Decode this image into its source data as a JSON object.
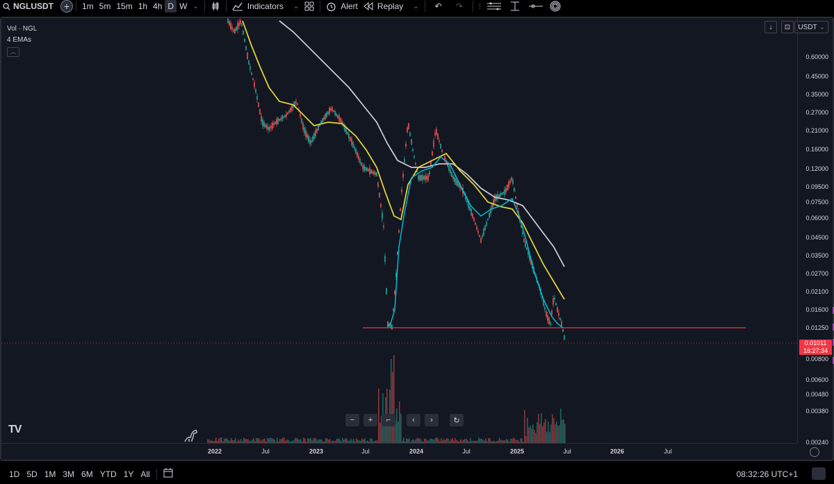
{
  "toolbar": {
    "symbol": "NGLUSDT",
    "intervals": [
      "1m",
      "5m",
      "15m",
      "1h",
      "4h",
      "D",
      "W"
    ],
    "active_interval": "D",
    "indicators_label": "Indicators",
    "alert_label": "Alert",
    "replay_label": "Replay"
  },
  "legend": {
    "volume": "Vol · NGL",
    "emas": "4 EMAs"
  },
  "currency": "USDT",
  "price_axis": {
    "labels": [
      "0.60000",
      "0.45000",
      "0.35000",
      "0.27000",
      "0.21000",
      "0.16000",
      "0.12000",
      "0.09500",
      "0.07500",
      "0.06000",
      "0.04500",
      "0.03500",
      "0.02700",
      "0.02100",
      "0.01600",
      "0.01250",
      "0.00800",
      "0.00600",
      "0.00480",
      "0.00380",
      "0.00240"
    ],
    "current_price": "0.01011",
    "countdown": "16:27:34"
  },
  "time_axis": {
    "labels": [
      "2022",
      "Jul",
      "2023",
      "Jul",
      "2024",
      "Jul",
      "2025",
      "Jul",
      "2026",
      "Jul"
    ]
  },
  "support_line_price": "0.01250",
  "bottom": {
    "ranges": [
      "1D",
      "5D",
      "1M",
      "3M",
      "6M",
      "YTD",
      "1Y",
      "All"
    ],
    "clock": "08:32:26 UTC+1"
  },
  "colors": {
    "background": "#131722",
    "ema_fast": "#00bcd4",
    "ema_mid": "#e0d339",
    "ema_slow": "#c9c9d6",
    "support_line": "#f23645",
    "up": "#26a69a",
    "down": "#ef5350"
  },
  "icons": [
    "search-icon",
    "plus-circle-icon",
    "candle-type-icon",
    "indicators-icon",
    "templates-icon",
    "alert-icon",
    "replay-icon",
    "undo-icon",
    "redo-icon",
    "drawing-tools-icon",
    "scroll-down-icon",
    "auto-scale-icon",
    "date-range-icon",
    "settings-icon",
    "fullscreen-icon"
  ]
}
